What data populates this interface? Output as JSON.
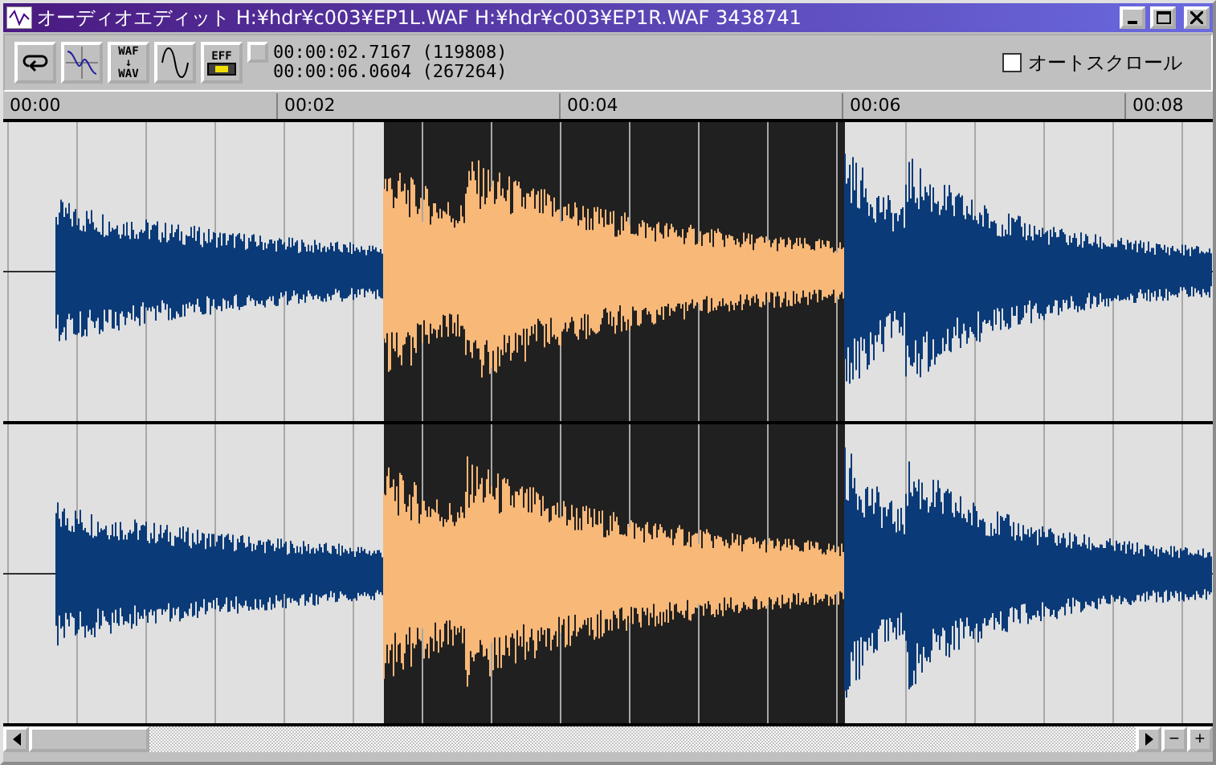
{
  "window": {
    "title": "オーディオエディット H:¥hdr¥c003¥EP1L.WAF H:¥hdr¥c003¥EP1R.WAF  3438741"
  },
  "toolbar": {
    "buttons": [
      {
        "kind": "loop"
      },
      {
        "kind": "wave-cross"
      },
      {
        "kind": "convert",
        "top": "WAF",
        "arrow": "↓",
        "bottom": "WAV"
      },
      {
        "kind": "sine"
      },
      {
        "kind": "effect",
        "label": "EFF"
      }
    ],
    "selection_start": "00:00:02.7167 (119808)",
    "selection_end": "00:00:06.0604 (267264)",
    "autoscroll": {
      "label": "オートスクロール",
      "checked": false
    }
  },
  "ruler": [
    "00:00",
    "00:02",
    "00:04",
    "00:06",
    "00:08"
  ],
  "channels": [
    {
      "kind": "waveform"
    },
    {
      "kind": "waveform"
    }
  ],
  "scrollbar": {
    "zoom_out": "−",
    "zoom_in": "+"
  }
}
